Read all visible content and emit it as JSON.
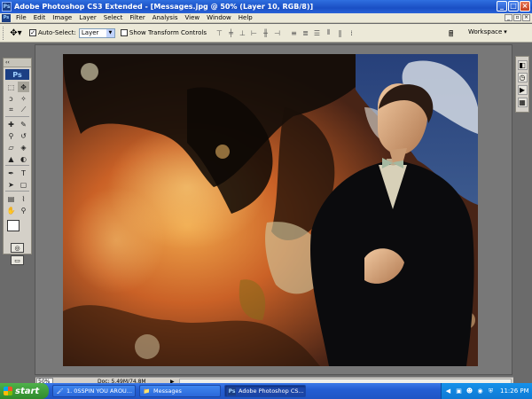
{
  "window": {
    "title": "Adobe Photoshop CS3 Extended - [Messages.jpg @ 50% (Layer 10, RGB/8)]",
    "app_icon": "Ps",
    "controls": [
      "minimize",
      "maximize",
      "close"
    ]
  },
  "menubar": {
    "items": [
      "File",
      "Edit",
      "Image",
      "Layer",
      "Select",
      "Filter",
      "Analysis",
      "View",
      "Window",
      "Help"
    ]
  },
  "options": {
    "auto_select_label": "Auto-Select:",
    "auto_select_checked": true,
    "layer_select_value": "Layer",
    "show_transform_label": "Show Transform Controls",
    "show_transform_checked": false,
    "workspace_label": "Workspace"
  },
  "toolbox": {
    "header": "‹‹",
    "logo": "Ps"
  },
  "document": {
    "zoom": "50%",
    "doc_info": "Doc: 5.49M/74.8M",
    "image_description_colors": {
      "fire_orange": "#c8571a",
      "dark": "#120c08",
      "paper": "#e3d6b8",
      "sky_blue": "#27407a"
    }
  },
  "taskbar": {
    "start_label": "start",
    "tasks": [
      {
        "label": "1. 0SSPIN YOU AROU...",
        "icon": "paint-icon"
      },
      {
        "label": "Messages",
        "icon": "folder-icon"
      },
      {
        "label": "Adobe Photoshop CS...",
        "icon": "photoshop-icon",
        "active": true
      }
    ],
    "clock": "11:26 PM"
  }
}
